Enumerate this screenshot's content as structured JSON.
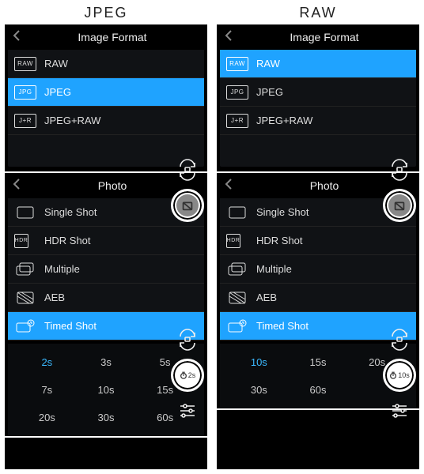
{
  "columns": [
    {
      "title": "JPEG",
      "image_format": {
        "header": "Image Format",
        "items": [
          {
            "tag": "RAW",
            "label": "RAW",
            "selected": false
          },
          {
            "tag": "JPG",
            "label": "JPEG",
            "selected": true
          },
          {
            "tag": "J+R",
            "label": "JPEG+RAW",
            "selected": false
          }
        ]
      },
      "photo": {
        "header": "Photo",
        "items": [
          {
            "kind": "single",
            "label": "Single Shot",
            "selected": false
          },
          {
            "kind": "hdr",
            "label": "HDR Shot",
            "selected": false
          },
          {
            "kind": "multiple",
            "label": "Multiple",
            "selected": false
          },
          {
            "kind": "aeb",
            "label": "AEB",
            "selected": false
          },
          {
            "kind": "timed",
            "label": "Timed Shot",
            "selected": true
          }
        ],
        "timed_options": [
          "2s",
          "3s",
          "5s",
          "7s",
          "10s",
          "15s",
          "20s",
          "30s",
          "60s"
        ],
        "timed_options_visible": [
          "2s",
          "3s",
          "5s",
          "7s",
          "10s",
          "15s",
          "20s",
          "30s",
          "60s"
        ],
        "timed_selected": "2s",
        "timer_badge": "2s"
      }
    },
    {
      "title": "RAW",
      "image_format": {
        "header": "Image Format",
        "items": [
          {
            "tag": "RAW",
            "label": "RAW",
            "selected": true
          },
          {
            "tag": "JPG",
            "label": "JPEG",
            "selected": false
          },
          {
            "tag": "J+R",
            "label": "JPEG+RAW",
            "selected": false
          }
        ]
      },
      "photo": {
        "header": "Photo",
        "items": [
          {
            "kind": "single",
            "label": "Single Shot",
            "selected": false
          },
          {
            "kind": "hdr",
            "label": "HDR Shot",
            "selected": false
          },
          {
            "kind": "multiple",
            "label": "Multiple",
            "selected": false
          },
          {
            "kind": "aeb",
            "label": "AEB",
            "selected": false
          },
          {
            "kind": "timed",
            "label": "Timed Shot",
            "selected": true
          }
        ],
        "timed_options": [
          "10s",
          "15s",
          "20s",
          "30s",
          "60s"
        ],
        "timed_options_visible": [
          "10s",
          "15s",
          "20s",
          "30s",
          "60s"
        ],
        "timed_selected": "10s",
        "timer_badge": "10s"
      }
    }
  ]
}
